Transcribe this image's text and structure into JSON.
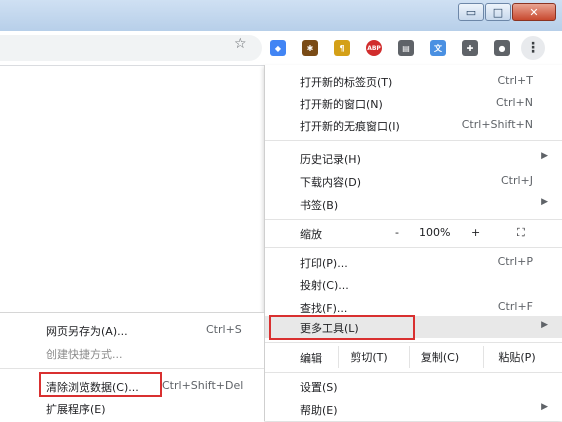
{
  "window": {
    "buttons": [
      {
        "name": "minimize-button",
        "glyph": "▭"
      },
      {
        "name": "maximize-button",
        "glyph": "□"
      },
      {
        "name": "close-button",
        "glyph": "✕"
      }
    ]
  },
  "toolbar": {
    "bookmark_star": "☆",
    "extensions": [
      {
        "name": "google-apps-extension-icon",
        "glyph": "◆",
        "color": "#4285f4"
      },
      {
        "name": "puzzle-robot-extension-icon",
        "glyph": "✱",
        "color": "#7a4b16"
      },
      {
        "name": "paragraph-extension-icon",
        "glyph": "¶",
        "color": "#d4a017"
      },
      {
        "name": "adblock-plus-icon",
        "glyph": "ABP",
        "color": "#d12d2d"
      },
      {
        "name": "reader-extension-icon",
        "glyph": "▤",
        "color": "#5f6368"
      },
      {
        "name": "translate-extension-icon",
        "glyph": "文",
        "color": "#4a90e2"
      },
      {
        "name": "extensions-puzzle-icon",
        "glyph": "✚",
        "color": "#5f6368"
      },
      {
        "name": "profile-avatar-icon",
        "glyph": "●",
        "color": "#5f6368"
      }
    ],
    "menu_glyph": "⋮"
  },
  "menu": {
    "new_tab": {
      "label": "打开新的标签页(T)",
      "shortcut": "Ctrl+T"
    },
    "new_window": {
      "label": "打开新的窗口(N)",
      "shortcut": "Ctrl+N"
    },
    "new_incognito": {
      "label": "打开新的无痕窗口(I)",
      "shortcut": "Ctrl+Shift+N"
    },
    "history": {
      "label": "历史记录(H)",
      "arrow": "▶"
    },
    "downloads": {
      "label": "下载内容(D)",
      "shortcut": "Ctrl+J"
    },
    "bookmarks": {
      "label": "书签(B)",
      "arrow": "▶"
    },
    "zoom": {
      "label": "缩放",
      "minus": "-",
      "value": "100%",
      "plus": "+",
      "fullscreen": "⛶"
    },
    "print": {
      "label": "打印(P)...",
      "shortcut": "Ctrl+P"
    },
    "cast": {
      "label": "投射(C)..."
    },
    "find": {
      "label": "查找(F)...",
      "shortcut": "Ctrl+F"
    },
    "more_tools": {
      "label": "更多工具(L)",
      "arrow": "▶"
    },
    "edit": {
      "label": "编辑",
      "cut": "剪切(T)",
      "copy": "复制(C)",
      "paste": "粘贴(P)"
    },
    "settings": {
      "label": "设置(S)"
    },
    "help": {
      "label": "帮助(E)",
      "arrow": "▶"
    }
  },
  "submenu": {
    "save_as": {
      "label": "网页另存为(A)...",
      "shortcut": "Ctrl+S"
    },
    "create_shortcut": {
      "label": "创建快捷方式..."
    },
    "clear_data": {
      "label": "清除浏览数据(C)...",
      "shortcut": "Ctrl+Shift+Del"
    },
    "extensions": {
      "label": "扩展程序(E)"
    }
  }
}
